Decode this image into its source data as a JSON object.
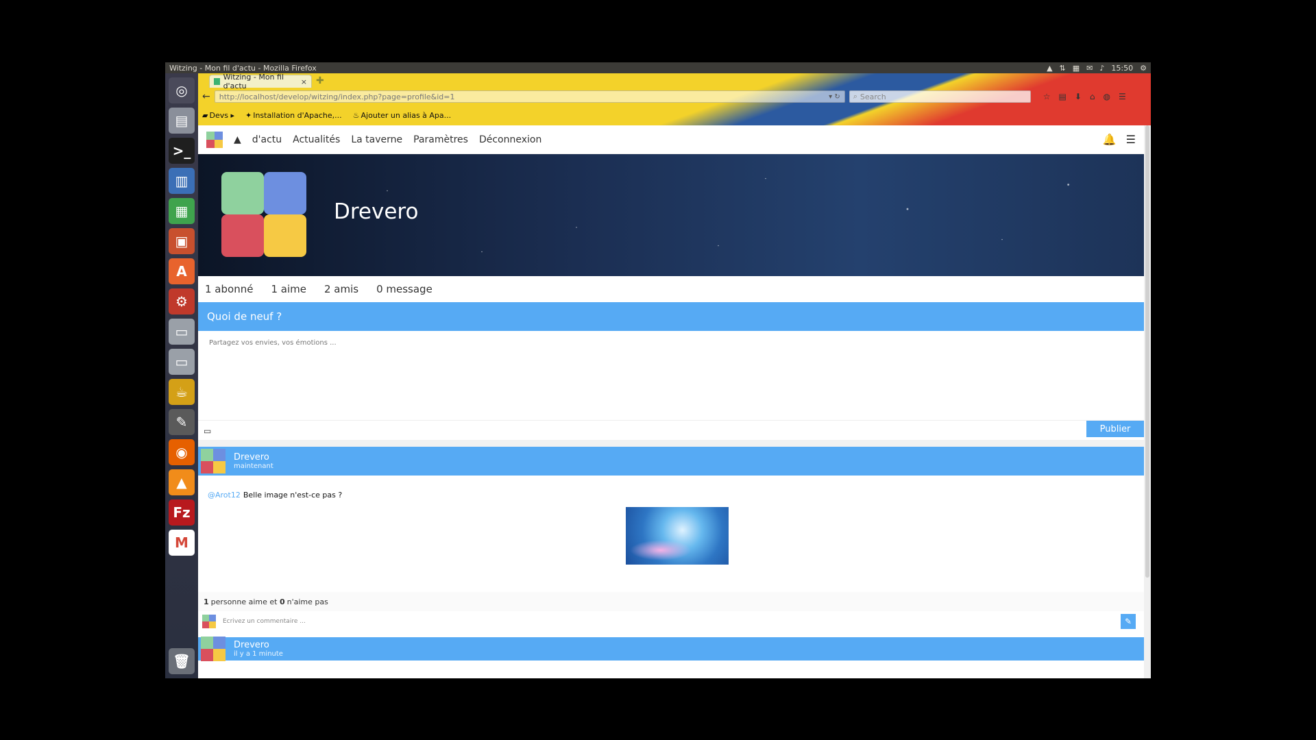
{
  "os": {
    "window_title": "Witzing - Mon fil d'actu - Mozilla Firefox",
    "clock": "15:50"
  },
  "browser": {
    "tab_title": "Witzing - Mon fil d'actu",
    "url": "http://localhost/develop/witzing/index.php?page=profile&id=1",
    "search_placeholder": "Search",
    "bookmarks": [
      {
        "label": "Devs"
      },
      {
        "label": "Installation d'Apache,..."
      },
      {
        "label": "Ajouter un alias à Apa..."
      }
    ]
  },
  "site": {
    "nav": [
      "d'actu",
      "Actualités",
      "La taverne",
      "Paramètres",
      "Déconnexion"
    ],
    "profile_name": "Drevero",
    "stats": [
      "1 abonné",
      "1 aime",
      "2 amis",
      "0 message"
    ],
    "composer": {
      "title": "Quoi de neuf ?",
      "placeholder": "Partagez vos envies, vos émotions ...",
      "publish": "Publier"
    },
    "posts": [
      {
        "author": "Drevero",
        "time": "maintenant",
        "mention": "@Arot12",
        "text": "Belle image n'est-ce pas ?",
        "likes_count": "1",
        "likes_text": "personne aime et",
        "dislikes_count": "0",
        "dislikes_text": "n'aime pas",
        "comment_placeholder": "Ecrivez un commentaire ..."
      },
      {
        "author": "Drevero",
        "time": "il y a 1 minute"
      }
    ]
  },
  "colors": {
    "accent": "#56aaf4",
    "logo_green": "#8fd19e",
    "logo_blue": "#6d8fe0",
    "logo_red": "#d9505d",
    "logo_yellow": "#f6c944"
  }
}
